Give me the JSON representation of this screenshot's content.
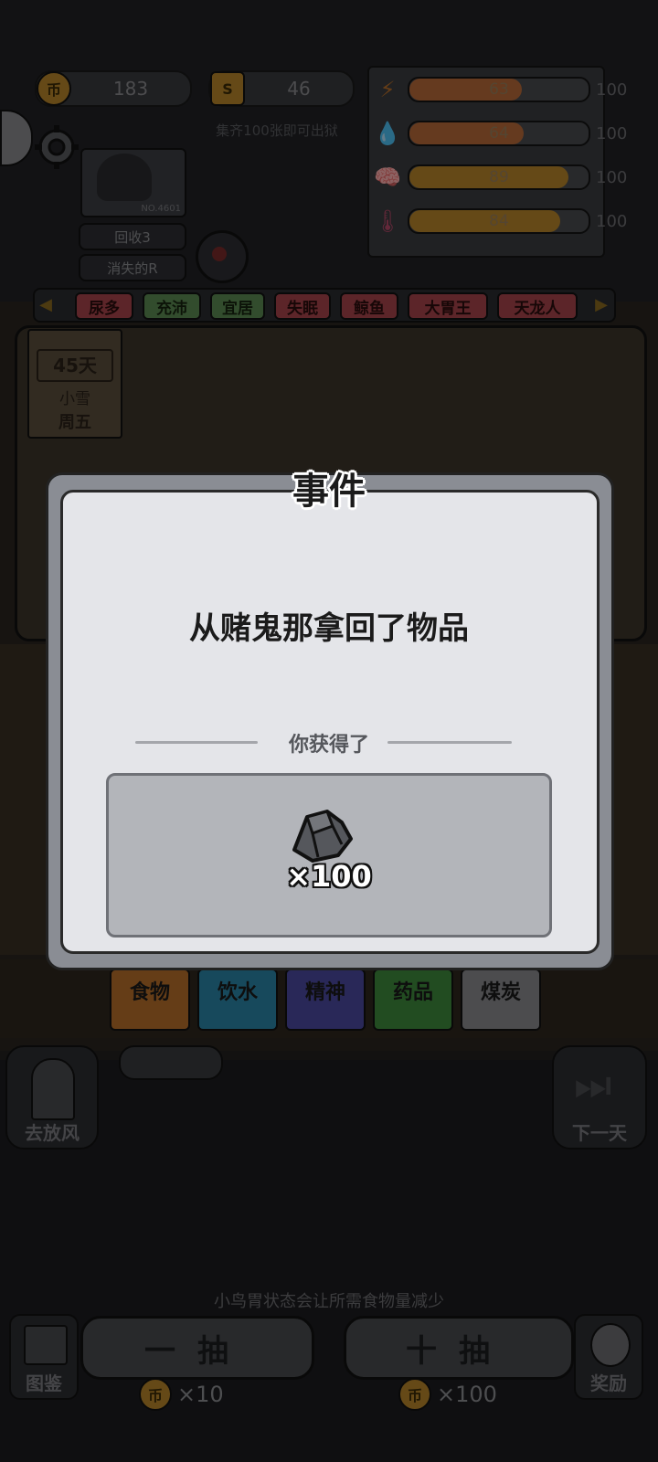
{
  "resources": {
    "coins": "183",
    "scratch": "46",
    "coin_symbol": "币",
    "scratch_symbol": "S",
    "hint": "集齐100张即可出狱"
  },
  "stats": [
    {
      "icon": "lightning-icon",
      "value": "63",
      "max": "100",
      "fraction": 0.63,
      "color": "#b86a3a"
    },
    {
      "icon": "water-drop-icon",
      "value": "64",
      "max": "100",
      "fraction": 0.64,
      "color": "#b86a3a"
    },
    {
      "icon": "brain-icon",
      "value": "89",
      "max": "100",
      "fraction": 0.89,
      "color": "#b8862a"
    },
    {
      "icon": "thermometer-icon",
      "value": "84",
      "max": "100",
      "fraction": 0.84,
      "color": "#b8862a"
    }
  ],
  "character": {
    "id_label": "NO.4601",
    "recycle": "回收3",
    "rarity": "消失的R"
  },
  "tags": [
    {
      "label": "尿多",
      "color": "red"
    },
    {
      "label": "充沛",
      "color": "green"
    },
    {
      "label": "宜居",
      "color": "green"
    },
    {
      "label": "失眠",
      "color": "red"
    },
    {
      "label": "鲸鱼",
      "color": "red"
    },
    {
      "label": "大胃王",
      "color": "red"
    },
    {
      "label": "天龙人",
      "color": "red"
    }
  ],
  "day": {
    "days": "45天",
    "weather": "小雪",
    "weekday": "周五"
  },
  "shelf": [
    {
      "label": "食物",
      "color": "#b8702a"
    },
    {
      "label": "饮水",
      "color": "#2a86a8"
    },
    {
      "label": "精神",
      "color": "#4b4aa0"
    },
    {
      "label": "药品",
      "color": "#3e8a3c"
    },
    {
      "label": "煤炭",
      "color": "#8a8b8f"
    }
  ],
  "controls": {
    "go_out": "去放风",
    "next_day": "下一天",
    "tip": "小鸟胃状态会让所需食物量减少",
    "catalog": "图鉴",
    "reward": "奖励",
    "draw_one": "一抽",
    "draw_ten": "十抽",
    "cost_one": "×10",
    "cost_ten": "×100"
  },
  "modal": {
    "title": "事件",
    "message": "从赌鬼那拿回了物品",
    "reward_label": "你获得了",
    "reward_item_icon": "coal-icon",
    "reward_qty": "×100"
  }
}
